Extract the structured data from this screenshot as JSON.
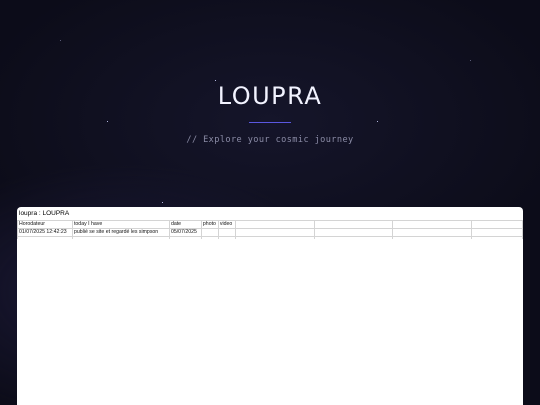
{
  "hero": {
    "title": "LOUPRA",
    "tagline": "// Explore your cosmic journey"
  },
  "colors": {
    "background": "#0c0c19",
    "accent": "#5a57e0",
    "title": "#f2f3ff",
    "tagline": "#8b8ca6",
    "sheet_background": "#ffffff"
  },
  "sheet": {
    "title": "loupra : LOUPRA",
    "headers": [
      "Horodateur",
      "today I have",
      "date",
      "photo",
      "video",
      "",
      "",
      "",
      ""
    ],
    "rows": [
      [
        "01/07/2025 12:42:23",
        "publié se site et regardé les simpson",
        "05/07/2025",
        "",
        "",
        "",
        "",
        "",
        ""
      ]
    ]
  }
}
